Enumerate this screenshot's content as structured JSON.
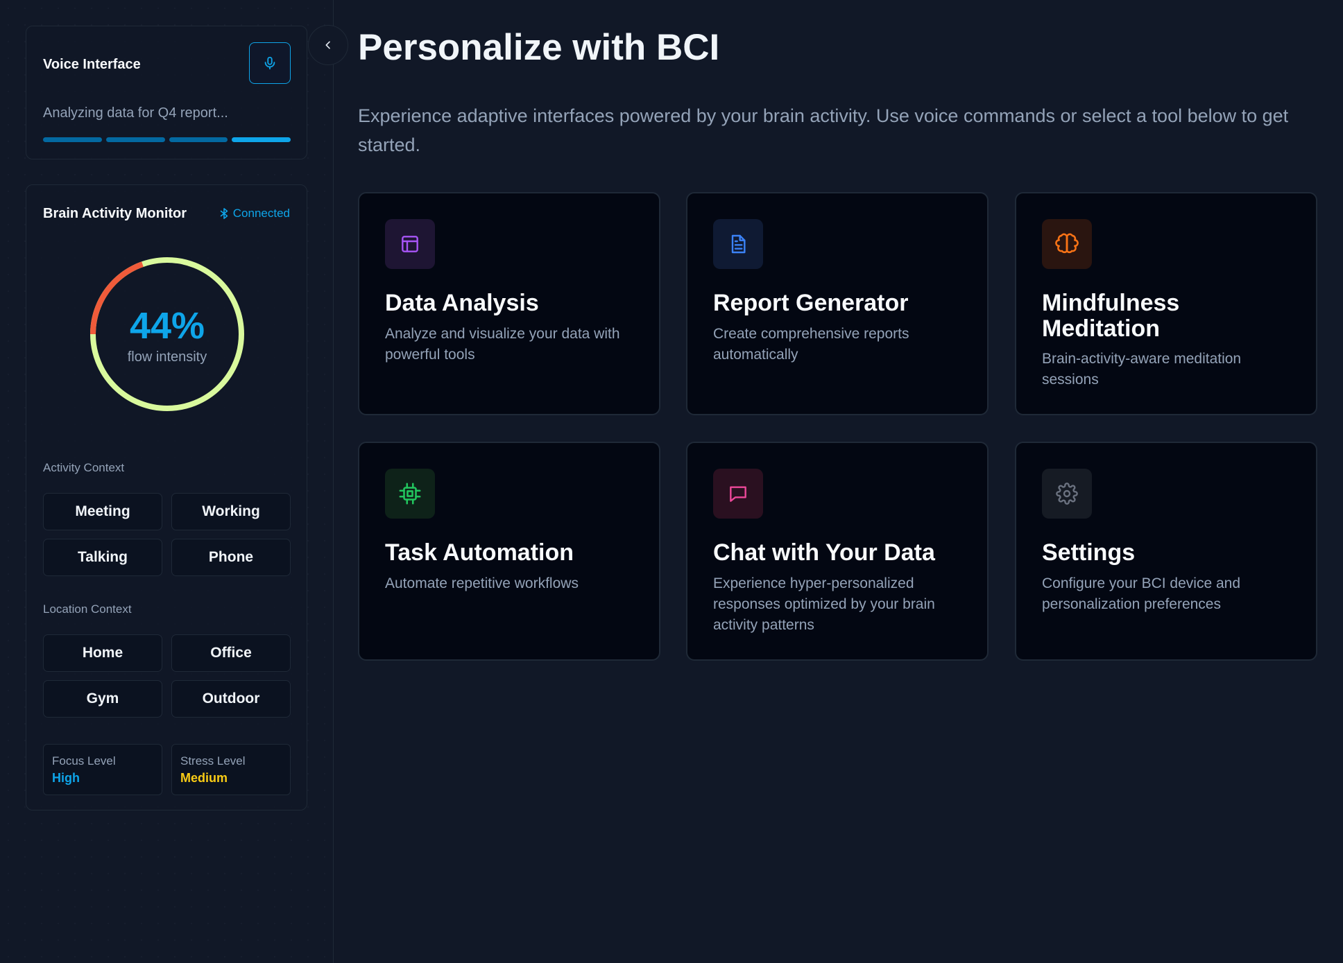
{
  "voice": {
    "title": "Voice Interface",
    "status": "Analyzing data for Q4 report...",
    "mic_icon": "microphone-icon"
  },
  "brain": {
    "title": "Brain Activity Monitor",
    "connection": "Connected",
    "gauge_value": "44%",
    "gauge_fraction": 0.44,
    "gauge_label": "flow intensity",
    "activity_label": "Activity Context",
    "activity": [
      "Meeting",
      "Working",
      "Talking",
      "Phone"
    ],
    "location_label": "Location Context",
    "location": [
      "Home",
      "Office",
      "Gym",
      "Outdoor"
    ],
    "focus_name": "Focus Level",
    "focus_value": "High",
    "stress_name": "Stress Level",
    "stress_value": "Medium"
  },
  "main": {
    "title": "Personalize with BCI",
    "subtitle": "Experience adaptive interfaces powered by your brain activity. Use voice commands or select a tool below to get started.",
    "cards": [
      {
        "title": "Data Analysis",
        "desc": "Analyze and visualize your data with powerful tools",
        "icon": "layout-icon"
      },
      {
        "title": "Report Generator",
        "desc": "Create comprehensive reports automatically",
        "icon": "document-icon"
      },
      {
        "title": "Mindfulness Meditation",
        "desc": "Brain-activity-aware meditation sessions",
        "icon": "brain-icon"
      },
      {
        "title": "Task Automation",
        "desc": "Automate repetitive workflows",
        "icon": "cpu-icon"
      },
      {
        "title": "Chat with Your Data",
        "desc": "Experience hyper-personalized responses optimized by your brain activity patterns",
        "icon": "chat-icon"
      },
      {
        "title": "Settings",
        "desc": "Configure your BCI device and personalization preferences",
        "icon": "gear-icon"
      }
    ]
  },
  "colors": {
    "accent": "#0ea5e9",
    "gauge_active": "#d9f99d",
    "gauge_warn": "#ef5b3a",
    "focus": "#0ea5e9",
    "stress": "#facc15"
  }
}
